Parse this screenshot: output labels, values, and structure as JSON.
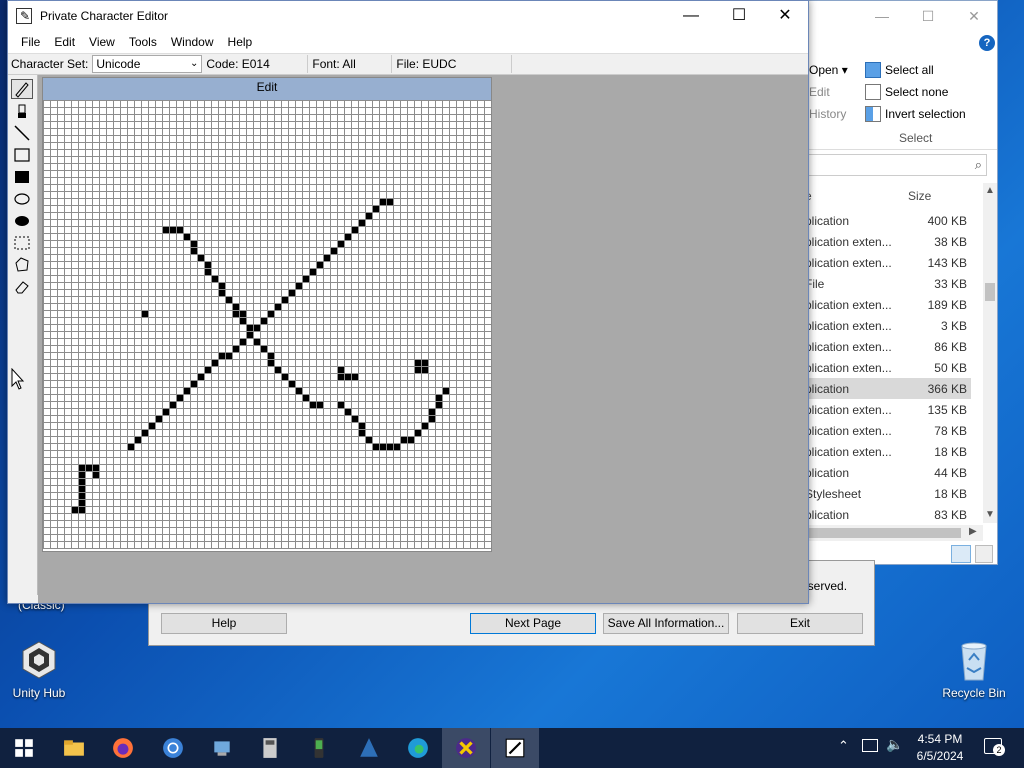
{
  "desktop": {
    "icons": [
      {
        "label": "Unity Hub"
      },
      {
        "label": "Recycle Bin"
      }
    ],
    "partial_label": "(Classic)"
  },
  "explorer": {
    "ribbon": {
      "open": "Open ▾",
      "edit": "Edit",
      "history": "History",
      "select_all": "Select all",
      "select_none": "Select none",
      "invert_selection": "Invert selection",
      "group_select": "Select"
    },
    "columns": {
      "type": "e",
      "size": "Size"
    },
    "rows": [
      {
        "type": "plication",
        "size": "400 KB"
      },
      {
        "type": "plication exten...",
        "size": "38 KB"
      },
      {
        "type": "plication exten...",
        "size": "143 KB"
      },
      {
        "type": "File",
        "size": "33 KB"
      },
      {
        "type": "plication exten...",
        "size": "189 KB"
      },
      {
        "type": "plication exten...",
        "size": "3 KB"
      },
      {
        "type": "plication exten...",
        "size": "86 KB"
      },
      {
        "type": "plication exten...",
        "size": "50 KB"
      },
      {
        "type": "plication",
        "size": "366 KB",
        "selected": true
      },
      {
        "type": "plication exten...",
        "size": "135 KB"
      },
      {
        "type": "plication exten...",
        "size": "78 KB"
      },
      {
        "type": "plication exten...",
        "size": "18 KB"
      },
      {
        "type": "plication",
        "size": "44 KB"
      },
      {
        "type": "Stylesheet",
        "size": "18 KB"
      },
      {
        "type": "plication",
        "size": "83 KB"
      }
    ]
  },
  "dialog": {
    "reserved_text": "eserved.",
    "buttons": {
      "help": "Help",
      "next_page": "Next Page",
      "save_all": "Save All Information...",
      "exit": "Exit"
    }
  },
  "editor": {
    "title": "Private Character Editor",
    "menu": [
      "File",
      "Edit",
      "View",
      "Tools",
      "Window",
      "Help"
    ],
    "info": {
      "charset_label": "Character Set:",
      "charset_value": "Unicode",
      "code": "Code: E014",
      "font": "Font: All",
      "file": "File: EUDC"
    },
    "edit_window_title": "Edit",
    "tools": [
      "pencil-tool-icon",
      "brush-tool-icon",
      "line-tool-icon",
      "hollow-rectangle-tool-icon",
      "filled-rectangle-tool-icon",
      "hollow-ellipse-tool-icon",
      "filled-ellipse-tool-icon",
      "rectangular-selection-icon",
      "freeform-selection-icon",
      "eraser-tool-icon"
    ],
    "grid_size": 64,
    "filled_cells": [
      [
        48,
        14
      ],
      [
        49,
        14
      ],
      [
        47,
        15
      ],
      [
        46,
        16
      ],
      [
        45,
        17
      ],
      [
        44,
        18
      ],
      [
        43,
        19
      ],
      [
        42,
        20
      ],
      [
        41,
        21
      ],
      [
        40,
        22
      ],
      [
        39,
        23
      ],
      [
        38,
        24
      ],
      [
        37,
        25
      ],
      [
        36,
        26
      ],
      [
        35,
        27
      ],
      [
        34,
        28
      ],
      [
        33,
        29
      ],
      [
        32,
        30
      ],
      [
        31,
        31
      ],
      [
        30,
        32
      ],
      [
        29,
        33
      ],
      [
        28,
        34
      ],
      [
        27,
        35
      ],
      [
        26,
        36
      ],
      [
        25,
        36
      ],
      [
        24,
        37
      ],
      [
        23,
        38
      ],
      [
        22,
        39
      ],
      [
        21,
        40
      ],
      [
        20,
        41
      ],
      [
        19,
        42
      ],
      [
        18,
        43
      ],
      [
        17,
        44
      ],
      [
        16,
        45
      ],
      [
        15,
        46
      ],
      [
        14,
        47
      ],
      [
        13,
        48
      ],
      [
        12,
        49
      ],
      [
        17,
        18
      ],
      [
        18,
        18
      ],
      [
        19,
        18
      ],
      [
        20,
        19
      ],
      [
        21,
        20
      ],
      [
        21,
        21
      ],
      [
        22,
        22
      ],
      [
        23,
        23
      ],
      [
        23,
        24
      ],
      [
        24,
        25
      ],
      [
        25,
        26
      ],
      [
        25,
        27
      ],
      [
        26,
        28
      ],
      [
        27,
        29
      ],
      [
        27,
        30
      ],
      [
        28,
        30
      ],
      [
        28,
        31
      ],
      [
        29,
        32
      ],
      [
        29,
        33
      ],
      [
        30,
        34
      ],
      [
        31,
        35
      ],
      [
        32,
        36
      ],
      [
        32,
        37
      ],
      [
        33,
        38
      ],
      [
        34,
        39
      ],
      [
        35,
        40
      ],
      [
        36,
        41
      ],
      [
        37,
        42
      ],
      [
        38,
        43
      ],
      [
        39,
        43
      ],
      [
        14,
        30
      ],
      [
        42,
        43
      ],
      [
        43,
        44
      ],
      [
        44,
        45
      ],
      [
        45,
        46
      ],
      [
        45,
        47
      ],
      [
        46,
        48
      ],
      [
        47,
        49
      ],
      [
        48,
        49
      ],
      [
        49,
        49
      ],
      [
        50,
        49
      ],
      [
        51,
        48
      ],
      [
        52,
        48
      ],
      [
        53,
        47
      ],
      [
        54,
        46
      ],
      [
        55,
        45
      ],
      [
        55,
        44
      ],
      [
        56,
        43
      ],
      [
        56,
        42
      ],
      [
        57,
        41
      ],
      [
        42,
        38
      ],
      [
        42,
        39
      ],
      [
        43,
        39
      ],
      [
        44,
        39
      ],
      [
        53,
        37
      ],
      [
        54,
        37
      ],
      [
        53,
        38
      ],
      [
        54,
        38
      ],
      [
        5,
        52
      ],
      [
        6,
        52
      ],
      [
        7,
        52
      ],
      [
        5,
        53
      ],
      [
        7,
        53
      ],
      [
        5,
        54
      ],
      [
        5,
        55
      ],
      [
        5,
        56
      ],
      [
        5,
        57
      ],
      [
        4,
        58
      ],
      [
        5,
        58
      ]
    ]
  },
  "taskbar": {
    "apps": [
      "windows-start-icon",
      "file-explorer-icon",
      "firefox-icon",
      "chrome-icon",
      "control-panel-icon",
      "calculator-icon",
      "phone-app-icon",
      "network-tool-icon",
      "edge-icon",
      "x-app-icon",
      "character-editor-icon"
    ],
    "time": "4:54 PM",
    "date": "6/5/2024",
    "notification_count": "2"
  },
  "colors": {
    "edit_header": "#97afd0",
    "workarea": "#a9a9a9",
    "taskbar": "#10213f",
    "desktop": "#0b4fb0"
  }
}
